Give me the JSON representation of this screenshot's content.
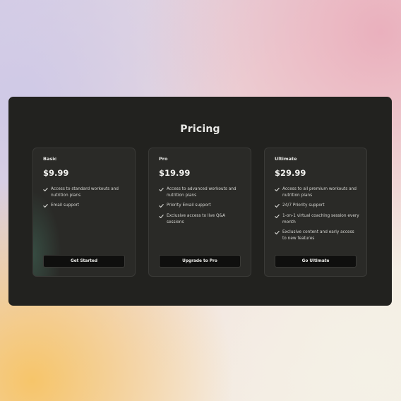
{
  "page": {
    "title": "Pricing"
  },
  "plans": [
    {
      "name": "Basic",
      "price": "$9.99",
      "features": [
        "Access to standard workouts and nutrition plans",
        "Email support"
      ],
      "cta": "Get Started"
    },
    {
      "name": "Pro",
      "price": "$19.99",
      "features": [
        "Access to advanced workouts and nutrition plans",
        "Priority Email support",
        "Exclusive access to live Q&A sessions"
      ],
      "cta": "Upgrade to Pro"
    },
    {
      "name": "Ultimate",
      "price": "$29.99",
      "features": [
        "Access to all premium workouts and nutrition plans",
        "24/7 Priority support",
        "1-on-1 virtual coaching session every month",
        "Exclusive content and early access to new features"
      ],
      "cta": "Go Ultimate"
    }
  ],
  "icons": {
    "feature_bullet": "check-icon",
    "pointer": "cursor-arrow-icon"
  },
  "colors": {
    "panel": "#22221f",
    "card": "#2a2a27",
    "button": "#0f0f0e",
    "text": "#e9e9e6"
  }
}
